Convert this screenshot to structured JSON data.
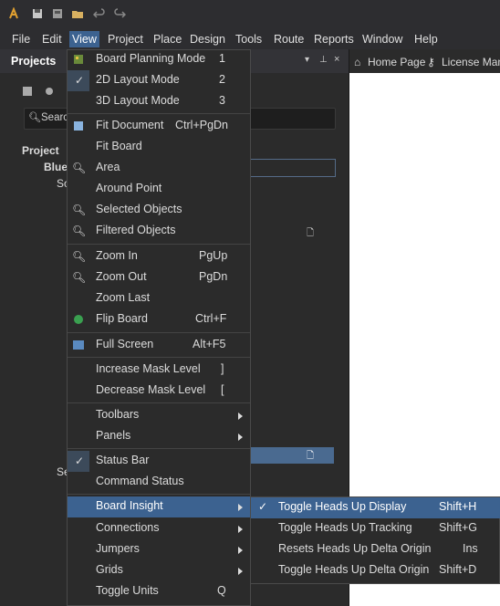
{
  "menubar": {
    "items": [
      "File",
      "Edit",
      "View",
      "Project",
      "Place",
      "Design",
      "Tools",
      "Route",
      "Reports",
      "Window",
      "Help"
    ]
  },
  "projects_panel": {
    "title": "Projects",
    "search_placeholder": "Search",
    "tree": {
      "projects_label": "Project",
      "root_label": "Blue",
      "source_label": "So",
      "settings_label": "Se"
    }
  },
  "doc_tabs": {
    "home": "Home Page",
    "license": "License Mana"
  },
  "view_menu": {
    "items": [
      {
        "label": "Board Planning Mode",
        "shortcut": "1"
      },
      {
        "label": "2D Layout Mode",
        "shortcut": "2",
        "checked": true
      },
      {
        "label": "3D Layout Mode",
        "shortcut": "3"
      },
      {
        "label": "Fit Document",
        "shortcut": "Ctrl+PgDn"
      },
      {
        "label": "Fit Board",
        "shortcut": ""
      },
      {
        "label": "Area",
        "shortcut": ""
      },
      {
        "label": "Around Point",
        "shortcut": ""
      },
      {
        "label": "Selected Objects",
        "shortcut": ""
      },
      {
        "label": "Filtered Objects",
        "shortcut": ""
      },
      {
        "label": "Zoom In",
        "shortcut": "PgUp"
      },
      {
        "label": "Zoom Out",
        "shortcut": "PgDn"
      },
      {
        "label": "Zoom Last",
        "shortcut": ""
      },
      {
        "label": "Flip Board",
        "shortcut": "Ctrl+F"
      },
      {
        "label": "Full Screen",
        "shortcut": "Alt+F5"
      },
      {
        "label": "Increase Mask Level",
        "shortcut": "]"
      },
      {
        "label": "Decrease Mask Level",
        "shortcut": "["
      },
      {
        "label": "Toolbars",
        "shortcut": ""
      },
      {
        "label": "Panels",
        "shortcut": ""
      },
      {
        "label": "Status Bar",
        "shortcut": "",
        "checked": true
      },
      {
        "label": "Command Status",
        "shortcut": ""
      },
      {
        "label": "Board Insight",
        "shortcut": ""
      },
      {
        "label": "Connections",
        "shortcut": ""
      },
      {
        "label": "Jumpers",
        "shortcut": ""
      },
      {
        "label": "Grids",
        "shortcut": ""
      },
      {
        "label": "Toggle Units",
        "shortcut": "Q"
      }
    ]
  },
  "board_insight_submenu": {
    "items": [
      {
        "label": "Toggle Heads Up Display",
        "shortcut": "Shift+H",
        "checked": true
      },
      {
        "label": "Toggle Heads Up Tracking",
        "shortcut": "Shift+G"
      },
      {
        "label": "Resets Heads Up Delta Origin",
        "shortcut": "Ins"
      },
      {
        "label": "Toggle Heads Up Delta Origin",
        "shortcut": "Shift+D"
      }
    ]
  },
  "colors": {
    "accent": "#3c6290",
    "background": "#2b2b2b",
    "document": "#ffffff"
  }
}
